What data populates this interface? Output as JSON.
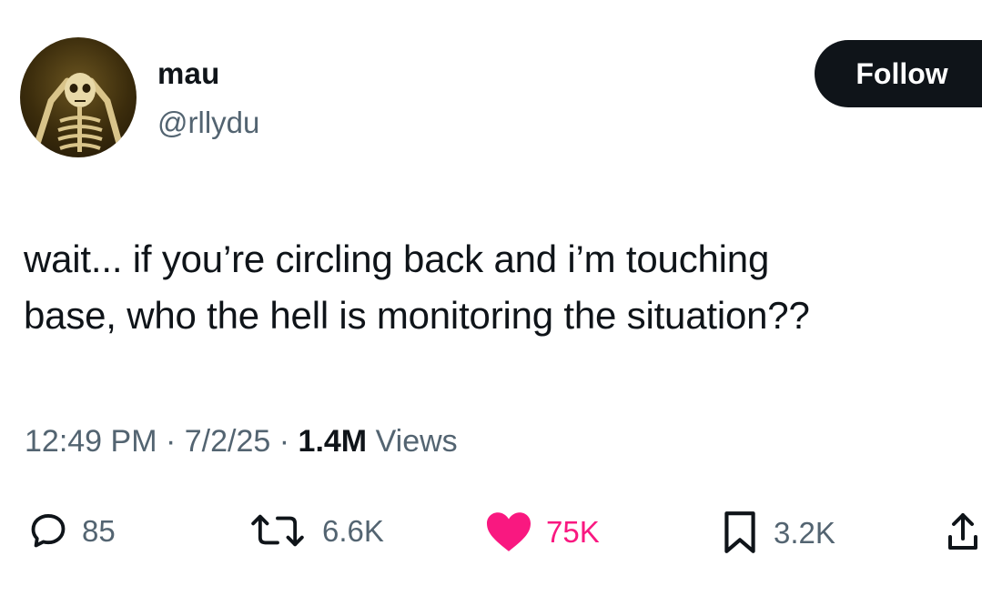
{
  "user": {
    "display_name": "mau",
    "handle": "@rllydu"
  },
  "follow_button": {
    "label": "Follow"
  },
  "tweet": {
    "lines": [
      "wait... if you’re circling back and i’m touching",
      "base, who the hell is monitoring the situation??"
    ]
  },
  "meta": {
    "time": "12:49 PM",
    "separator": "·",
    "date": "7/2/25",
    "views_count": "1.4M",
    "views_label": "Views"
  },
  "actions": {
    "reply_count": "85",
    "repost_count": "6.6K",
    "like_count": "75K",
    "bookmark_count": "3.2K"
  },
  "colors": {
    "text": "#0f1419",
    "secondary": "#536471",
    "like": "#f91880",
    "button_bg": "#0f1419"
  },
  "icons": [
    "avatar-skeleton",
    "reply-icon",
    "repost-icon",
    "heart-icon",
    "bookmark-icon",
    "share-icon"
  ]
}
